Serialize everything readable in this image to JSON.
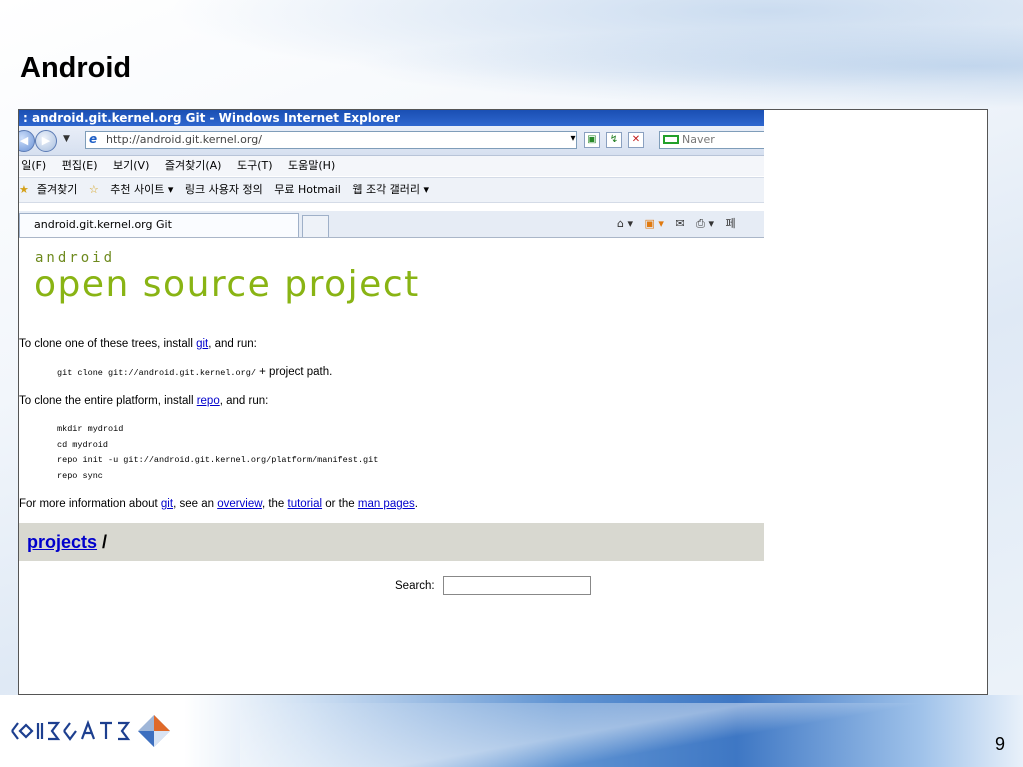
{
  "slide": {
    "title": "Android",
    "page_number": "9"
  },
  "browser": {
    "window_title": ": android.git.kernel.org Git - Windows Internet Explorer",
    "address": "http://android.git.kernel.org/",
    "search_provider": "Naver",
    "menu": [
      " 일(F)",
      "편집(E)",
      "보기(V)",
      "즐겨찾기(A)",
      "도구(T)",
      "도움말(H)"
    ],
    "favorites_label": "즐겨찾기",
    "favorites": [
      "추천 사이트 ▾",
      "링크 사용자 정의",
      "무료 Hotmail",
      "웹 조각 갤러리 ▾"
    ],
    "tab_title": "android.git.kernel.org Git",
    "cmd_page": "페"
  },
  "page": {
    "android_wordmark": "android",
    "headline": "open source project",
    "clone_one_prefix": "To clone one of these trees, install ",
    "clone_one_link": "git",
    "clone_one_suffix": ", and run:",
    "clone_one_code": "git clone git://android.git.kernel.org/",
    "clone_one_code_suffix": " + project path.",
    "clone_all_prefix": "To clone the entire platform, install ",
    "clone_all_link": "repo",
    "clone_all_suffix": ", and run:",
    "clone_all_code": [
      "mkdir mydroid",
      "cd mydroid",
      "repo init -u git://android.git.kernel.org/platform/manifest.git",
      "repo sync"
    ],
    "more_prefix": "For more information about ",
    "more_link_git": "git",
    "more_mid1": ", see an ",
    "more_link_overview": "overview",
    "more_mid2": ", the ",
    "more_link_tutorial": "tutorial",
    "more_mid3": " or the ",
    "more_link_man": "man pages",
    "more_end": ".",
    "projects_link": "projects",
    "projects_sep": " /",
    "search_label": "Search:",
    "search_value": ""
  },
  "footer": {
    "logo_text": "CODEGATE"
  }
}
